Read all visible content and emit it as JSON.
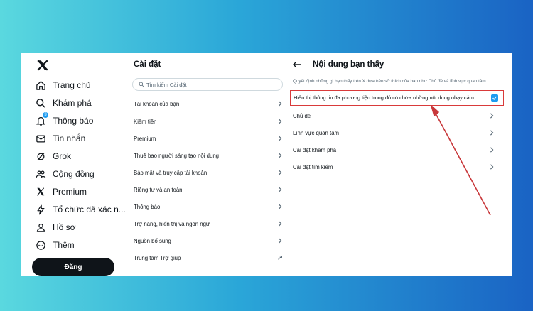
{
  "nav": {
    "items": [
      {
        "label": "Trang chủ",
        "icon": "home-icon"
      },
      {
        "label": "Khám phá",
        "icon": "search-icon"
      },
      {
        "label": "Thông báo",
        "icon": "bell-icon",
        "badge": "3"
      },
      {
        "label": "Tin nhắn",
        "icon": "mail-icon"
      },
      {
        "label": "Grok",
        "icon": "grok-icon"
      },
      {
        "label": "Cộng đồng",
        "icon": "people-icon"
      },
      {
        "label": "Premium",
        "icon": "x-logo-icon"
      },
      {
        "label": "Tổ chức đã xác n...",
        "icon": "lightning-icon"
      },
      {
        "label": "Hồ sơ",
        "icon": "person-icon"
      },
      {
        "label": "Thêm",
        "icon": "more-circle-icon"
      }
    ],
    "post_label": "Đăng"
  },
  "settings": {
    "title": "Cài đặt",
    "search_placeholder": "Tìm kiếm Cài đặt",
    "items": [
      "Tài khoản của bạn",
      "Kiếm tiền",
      "Premium",
      "Thuê bao người sáng tạo nội dung",
      "Bảo mật và truy cập tài khoản",
      "Riêng tư và an toàn",
      "Thông báo",
      "Trợ năng, hiển thị và ngôn ngữ",
      "Nguồn bổ sung",
      "Trung tâm Trợ giúp"
    ]
  },
  "content": {
    "title": "Nội dung bạn thấy",
    "description": "Quyết định những gì bạn thấy trên X dựa trên sở thích của bạn như Chủ đề và lĩnh vực quan tâm.",
    "sensitive_label": "Hiển thị thông tin đa phương tiện trong đó có chứa những nội dung nhạy cảm",
    "sensitive_checked": true,
    "items": [
      "Chủ đề",
      "Lĩnh vực quan tâm",
      "Cài đặt khám phá",
      "Cài đặt tìm kiếm"
    ]
  },
  "colors": {
    "accent": "#1d9bf0",
    "highlight": "#d93a3a",
    "text": "#0f1419"
  }
}
